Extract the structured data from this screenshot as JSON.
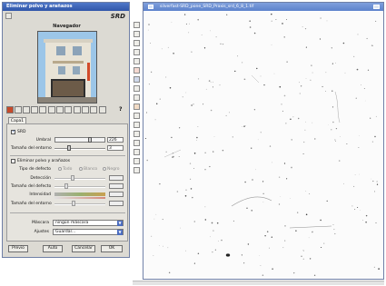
{
  "dialog": {
    "title": "Eliminar polvo y arañazos",
    "brand": "SRD",
    "navigator_label": "Navegador",
    "tab_label": "Capa1",
    "srd_label": "SRD",
    "umbral_label": "Umbral",
    "umbral_value": "226",
    "tamano_entorno_label": "Tamaño del entorno",
    "tamano_entorno_value": "3",
    "eliminar_label": "Eliminar polvo y arañazos",
    "tipo_defecto_label": "Tipo de defecto",
    "tipo_defecto_options": [
      "Todo",
      "Blanco",
      "Negro"
    ],
    "deteccion_label": "Detección",
    "tamano_defecto_label": "Tamaño del defecto",
    "intensidad_label": "Intensidad",
    "tamano_entorno2_label": "Tamaño del entorno",
    "mascara_label": "Máscara",
    "mascara_value": "ningún máscara",
    "ajustes_label": "Ajustes",
    "ajustes_value": "Guardar...",
    "buttons": {
      "preview": "Previo",
      "auto": "Auto",
      "cancel": "Cancelar",
      "ok": "OK"
    }
  },
  "image_window": {
    "title": "silverfast-SRD_pone_SRD_Praxis_srd_6_8_1.tif"
  },
  "colors": {
    "title_active": "#2f55a8",
    "title_inactive": "#5d82cc",
    "dialog_bg": "#dcdad3",
    "accent_red": "#c74a2a"
  },
  "icons": {
    "toolbar": [
      "settings-icon",
      "question-icon"
    ],
    "vertical_tools": [
      "hand-icon",
      "zoom-icon",
      "eyedropper-icon",
      "eyedropper-plus-icon",
      "eyedropper-minus-icon",
      "curve-icon",
      "crop-icon",
      "rotate-icon",
      "flip-icon",
      "info-icon",
      "color-icon",
      "levels-icon",
      "mask-icon",
      "srd-icon",
      "halftone-icon",
      "gear-icon",
      "grid-icon"
    ]
  }
}
